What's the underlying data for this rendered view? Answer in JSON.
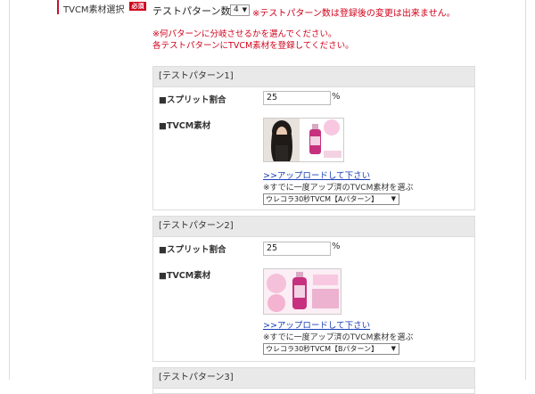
{
  "row": {
    "label": "TVCM素材選択",
    "required_badge": "必須",
    "count_label": "テストパターン数",
    "count_value": "4",
    "count_note": "※テストパターン数は登録後の変更は出来ません。"
  },
  "instructions": [
    "※何パターンに分岐させるかを選んでください。",
    "各テストパターンにTVCM素材を登録してください。"
  ],
  "patterns": [
    {
      "title": "[テストパターン1]",
      "split_label": "■スプリット割合",
      "split_value": "25",
      "percent": "%",
      "material_label": "■TVCM素材",
      "upload_link": ">>アップロードして下さい",
      "existing_note": "※すでに一度アップ済のTVCM素材を選ぶ",
      "selected_material": "ウレコラ30秒TVCM【Aパターン】"
    },
    {
      "title": "[テストパターン2]",
      "split_label": "■スプリット割合",
      "split_value": "25",
      "percent": "%",
      "material_label": "■TVCM素材",
      "upload_link": ">>アップロードして下さい",
      "existing_note": "※すでに一度アップ済のTVCM素材を選ぶ",
      "selected_material": "ウレコラ30秒TVCM【Bパターン】"
    },
    {
      "title": "[テストパターン3]"
    }
  ],
  "colors": {
    "accent_red": "#d0021b",
    "link_blue": "#1a3fb5",
    "header_gray": "#e9e9e9"
  },
  "icons": {
    "select_arrow": "▼"
  }
}
